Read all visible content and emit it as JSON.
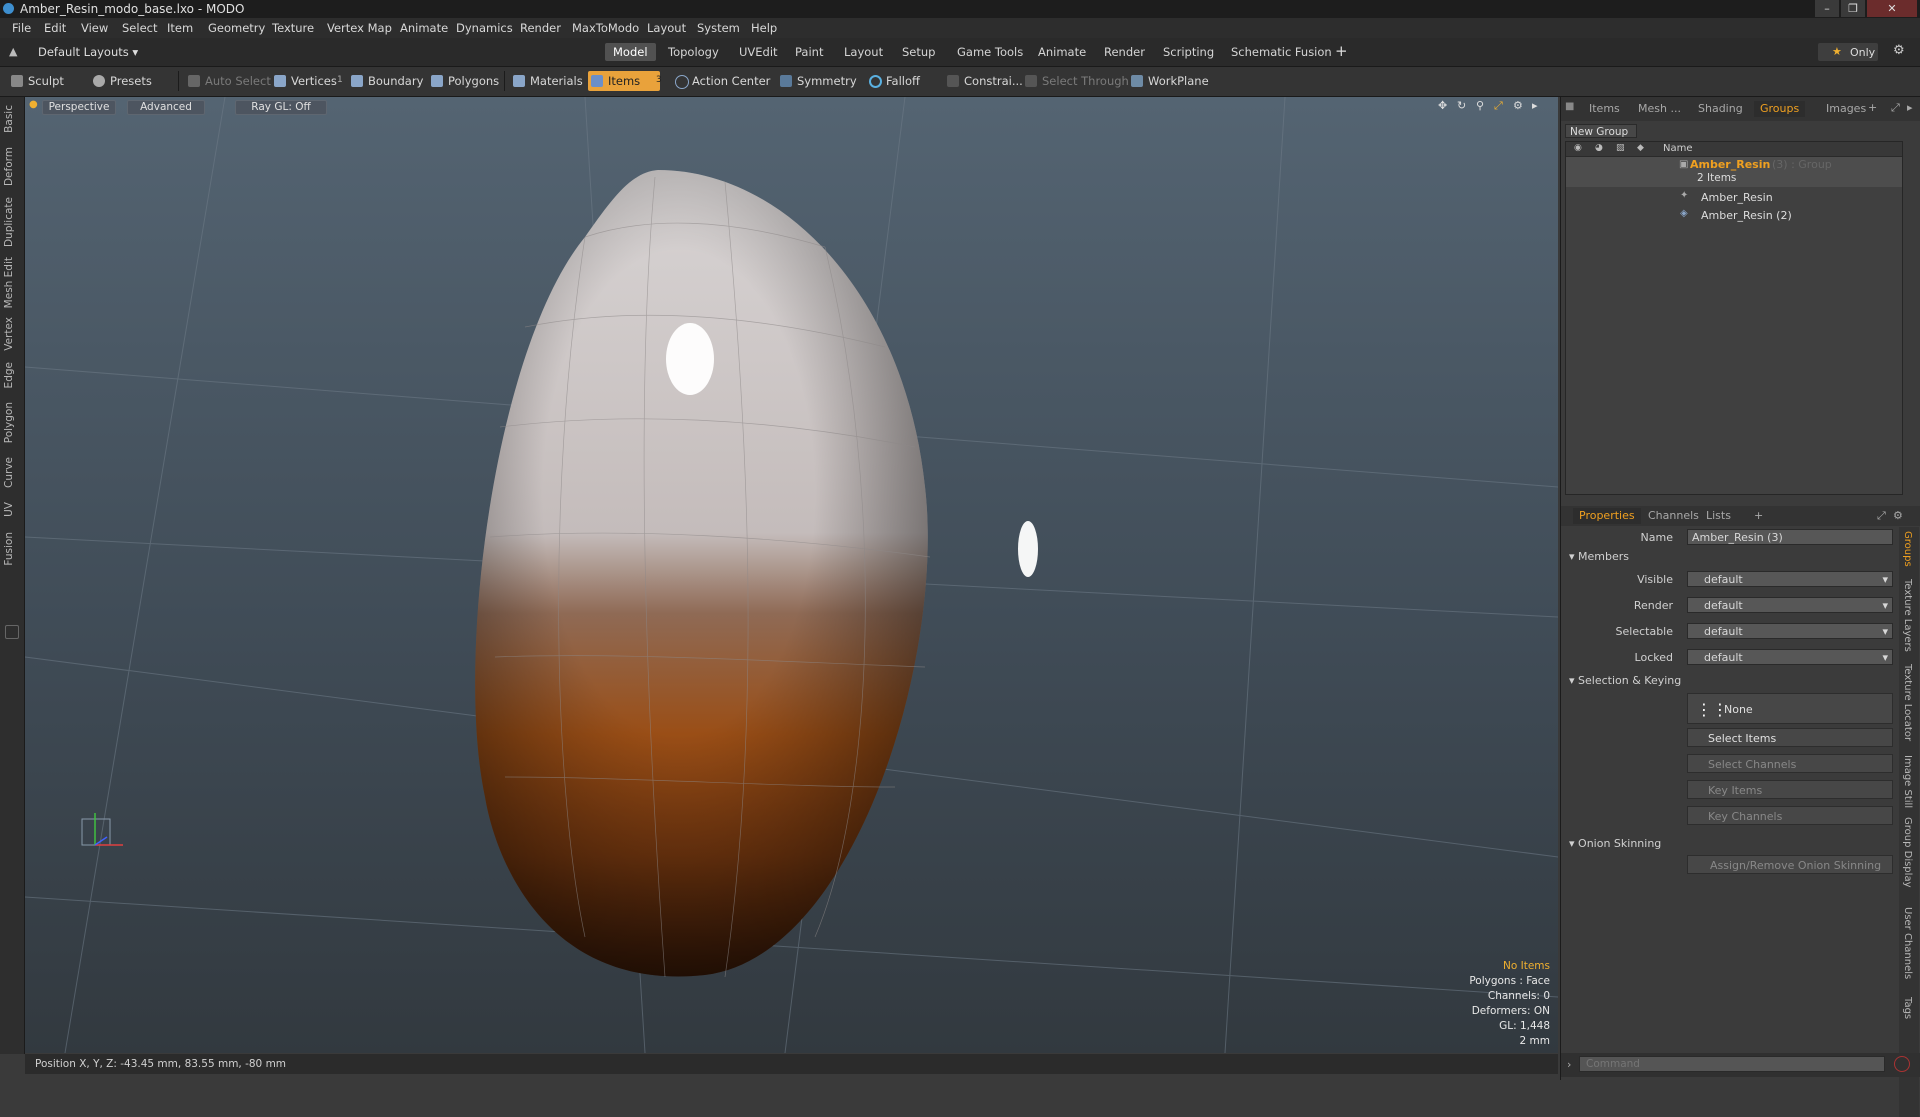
{
  "window": {
    "title": "Amber_Resin_modo_base.lxo - MODO"
  },
  "menu": [
    "File",
    "Edit",
    "View",
    "Select",
    "Item",
    "Geometry",
    "Texture",
    "Vertex Map",
    "Animate",
    "Dynamics",
    "Render",
    "MaxToModo",
    "Layout",
    "System",
    "Help"
  ],
  "layout_bar": {
    "preset": "Default Layouts",
    "tabs": [
      "Model",
      "Topology",
      "UVEdit",
      "Paint",
      "Layout",
      "Setup",
      "Game Tools",
      "Animate",
      "Render",
      "Scripting",
      "Schematic Fusion"
    ],
    "active_tab": "Model",
    "add_label": "+",
    "only_label": "Only"
  },
  "toolbar": {
    "sculpt": "Sculpt",
    "presets": "Presets",
    "auto_select": "Auto Select",
    "vertices": "Vertices",
    "vertices_count": "1",
    "boundary": "Boundary",
    "polygons": "Polygons",
    "materials": "Materials",
    "items": "Items",
    "items_count": "3",
    "action_center": "Action Center",
    "symmetry": "Symmetry",
    "falloff": "Falloff",
    "constrain": "Constrai...",
    "select_through": "Select Through",
    "workplane": "WorkPlane"
  },
  "left_tabs": [
    "Basic",
    "Deform",
    "Duplicate",
    "Mesh Edit",
    "Vertex",
    "Edge",
    "Polygon",
    "Curve",
    "UV",
    "Fusion"
  ],
  "viewport": {
    "projection": "Perspective",
    "shading": "Advanced",
    "raygl": "Ray GL: Off",
    "info": {
      "items": "No Items",
      "polygons": "Polygons : Face",
      "channels": "Channels: 0",
      "deformers": "Deformers: ON",
      "gl": "GL: 1,448",
      "grid": "2 mm"
    }
  },
  "status": {
    "position": "Position X, Y, Z:  -43.45 mm, 83.55 mm, -80 mm"
  },
  "right_panel": {
    "top_tabs": [
      "Items",
      "Mesh ...",
      "Shading",
      "Groups",
      "Images"
    ],
    "active_top_tab": "Groups",
    "new_group": "New Group",
    "col_name": "Name",
    "group": {
      "name": "Amber_Resin",
      "suffix": "(3) : Group",
      "count": "2 Items",
      "children": [
        "Amber_Resin",
        "Amber_Resin (2)"
      ]
    },
    "bottom_tabs": [
      "Properties",
      "Channels",
      "Lists"
    ],
    "active_bottom_tab": "Properties",
    "props": {
      "name_label": "Name",
      "name_value": "Amber_Resin (3)",
      "members": "Members",
      "visible_label": "Visible",
      "visible": "default",
      "render_label": "Render",
      "render": "default",
      "selectable_label": "Selectable",
      "selectable": "default",
      "locked_label": "Locked",
      "locked": "default",
      "selection_keying": "Selection & Keying",
      "none": "None",
      "select_items": "Select Items",
      "select_channels": "Select Channels",
      "key_items": "Key Items",
      "key_channels": "Key Channels",
      "onion_skinning": "Onion Skinning",
      "assign_onion": "Assign/Remove Onion Skinning"
    },
    "side_tabs": [
      "Groups",
      "Texture Layers",
      "Texture Locator",
      "Image Still",
      "Group Display",
      "User Channels",
      "Tags"
    ],
    "command_placeholder": "Command"
  },
  "colors": {
    "accent": "#e9a23b",
    "active_tab": "#f0a020"
  }
}
